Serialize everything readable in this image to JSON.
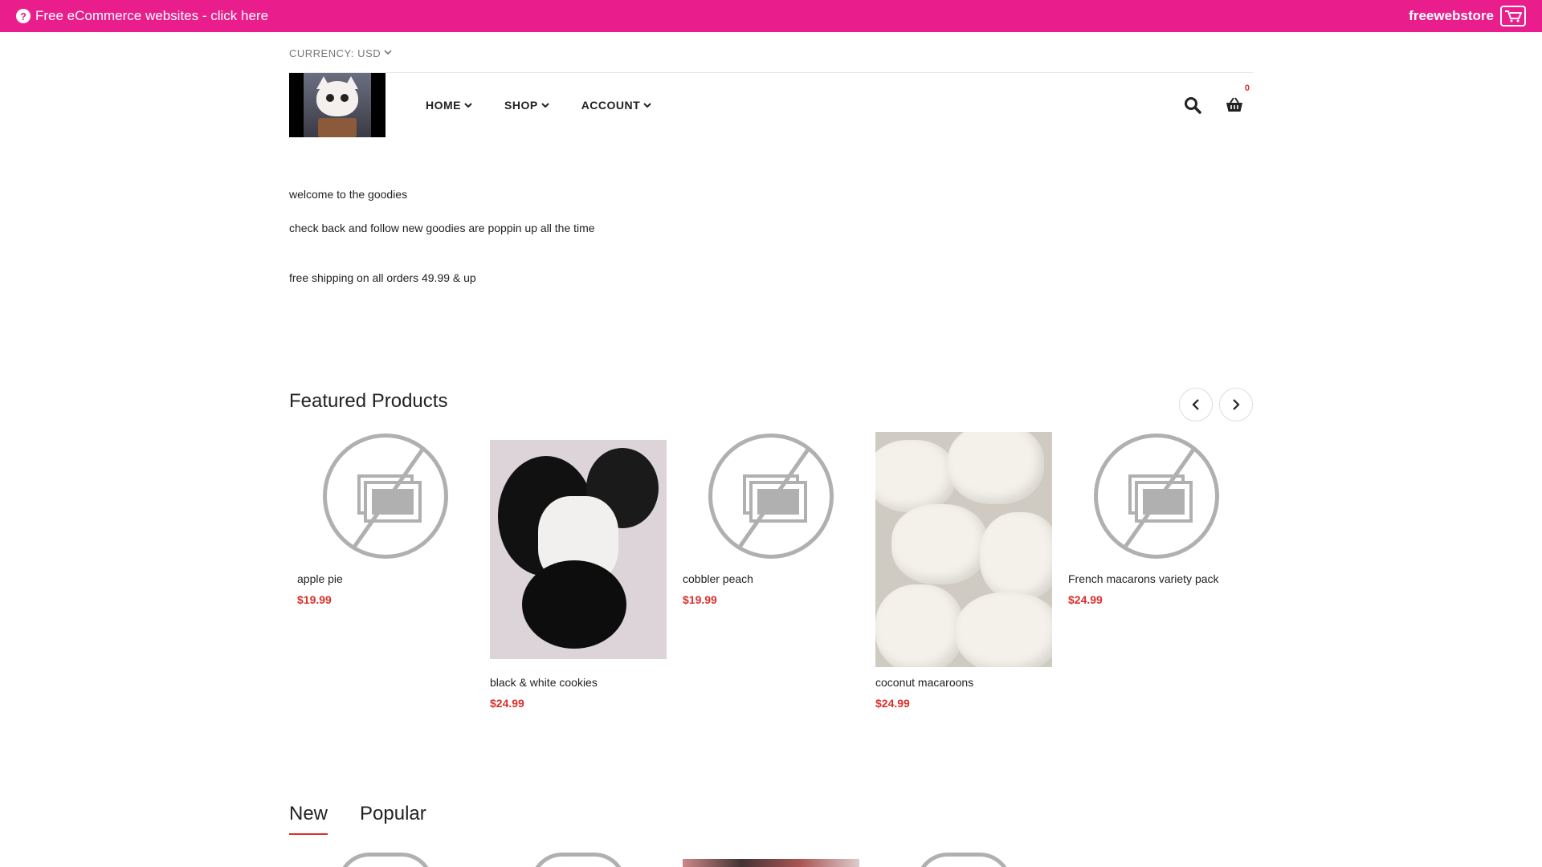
{
  "topbar": {
    "promo_text": "Free eCommerce websites - click here",
    "brand": "freewebstore",
    "help_icon": "question-circle-icon",
    "brand_icon": "cart-logo-icon",
    "color": "#e91e8c"
  },
  "currency": {
    "label": "CURRENCY: USD"
  },
  "nav": {
    "items": [
      {
        "label": "HOME"
      },
      {
        "label": "SHOP"
      },
      {
        "label": "ACCOUNT"
      }
    ],
    "cart_count": "0"
  },
  "intro": {
    "line1": "welcome to the goodies",
    "line2": "check back and follow new goodies are poppin up all the time",
    "line3": "free shipping on all orders 49.99 & up"
  },
  "featured": {
    "title": "Featured Products",
    "products": [
      {
        "name": "apple pie",
        "price": "$19.99",
        "image": "no-image"
      },
      {
        "name": "black & white cookies",
        "price": "$24.99",
        "image": "photo"
      },
      {
        "name": "cobbler peach",
        "price": "$19.99",
        "image": "no-image"
      },
      {
        "name": "coconut macaroons",
        "price": "$24.99",
        "image": "photo"
      },
      {
        "name": "French macarons variety pack",
        "price": "$24.99",
        "image": "no-image"
      }
    ]
  },
  "tabs": [
    {
      "label": "New",
      "active": true
    },
    {
      "label": "Popular",
      "active": false
    }
  ],
  "colors": {
    "accent": "#e91e8c",
    "price": "#d9302c"
  }
}
